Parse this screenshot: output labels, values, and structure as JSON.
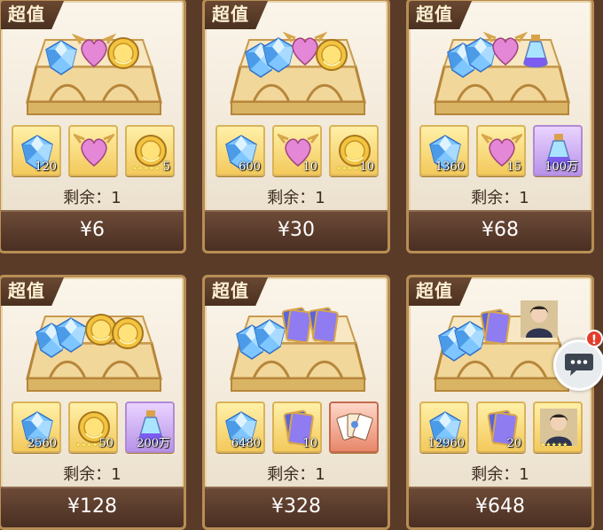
{
  "badge_label": "超值",
  "remaining_label": "剩余：1",
  "colors": {
    "frame": "#b88e55",
    "badge_bg": "#5a3b28",
    "price_bar": "#553627",
    "gold_tile": "#f3c95b",
    "purple_tile": "#b893e8",
    "red_tile": "#e7876a"
  },
  "offers": [
    {
      "price": "¥6",
      "items": [
        {
          "icon": "diamond-icon",
          "qty": "120"
        },
        {
          "icon": "heart-crest-icon",
          "qty": ""
        },
        {
          "icon": "gold-coin-icon",
          "qty": "5"
        }
      ]
    },
    {
      "price": "¥30",
      "items": [
        {
          "icon": "diamond-icon",
          "qty": "600"
        },
        {
          "icon": "heart-crest-icon",
          "qty": "10"
        },
        {
          "icon": "gold-coin-icon",
          "qty": "10"
        }
      ]
    },
    {
      "price": "¥68",
      "items": [
        {
          "icon": "diamond-icon",
          "qty": "1360"
        },
        {
          "icon": "heart-crest-icon",
          "qty": "15"
        },
        {
          "icon": "potion-icon",
          "qty": "100万"
        }
      ]
    },
    {
      "price": "¥128",
      "items": [
        {
          "icon": "diamond-icon",
          "qty": "2560"
        },
        {
          "icon": "gold-coin-icon",
          "qty": "50"
        },
        {
          "icon": "potion-icon",
          "qty": "200万"
        }
      ]
    },
    {
      "price": "¥328",
      "items": [
        {
          "icon": "diamond-icon",
          "qty": "6480"
        },
        {
          "icon": "card-pack-icon",
          "qty": "10"
        },
        {
          "icon": "card-fan-icon",
          "qty": ""
        }
      ]
    },
    {
      "price": "¥648",
      "items": [
        {
          "icon": "diamond-icon",
          "qty": "12960"
        },
        {
          "icon": "card-pack-icon",
          "qty": "20"
        },
        {
          "icon": "hero-portrait-icon",
          "qty": ""
        }
      ]
    }
  ]
}
